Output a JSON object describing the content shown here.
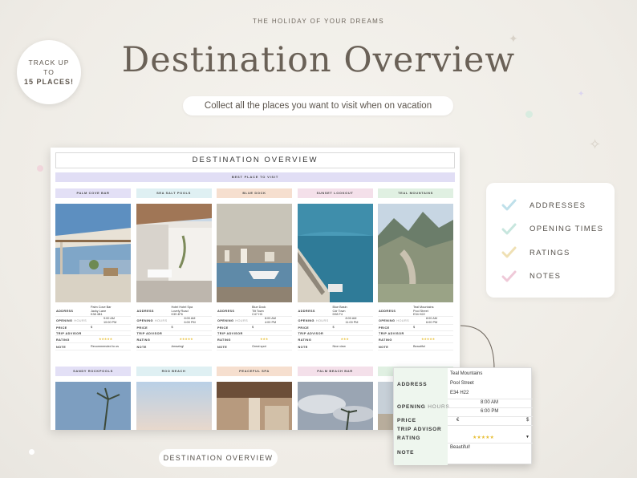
{
  "header": {
    "tagline": "THE HOLIDAY OF YOUR DREAMS",
    "title": "Destination Overview",
    "subtitle": "Collect all the places you want to visit when on vacation"
  },
  "badge": {
    "line1": "TRACK UP",
    "line2": "TO",
    "line3": "15 PLACES!"
  },
  "sheet": {
    "title": "DESTINATION OVERVIEW",
    "best_label": "BEST PLACE TO VISIT",
    "places": [
      {
        "name": "PALM COVE BAR",
        "head_color": "#e3e0f6",
        "address": [
          "Palm Cove Bar",
          "Jacky Lane",
          "K38 4B1"
        ],
        "open": "9:00 AM",
        "close": "10:00 PM",
        "price": "$",
        "rating": "★★★★★",
        "note": "Recommended to us"
      },
      {
        "name": "SEA SALT POOLS",
        "head_color": "#dff0f3",
        "address": [
          "Hotel Hotel Spa",
          "Lovely Road",
          "K39 4F6"
        ],
        "open": "8:00 AM",
        "close": "6:00 PM",
        "price": "$",
        "rating": "★★★★★",
        "note": "Amazing!"
      },
      {
        "name": "BLUE DOCK",
        "head_color": "#f6dfcf",
        "address": [
          "Blue Dock",
          "Tilt Town",
          "C47 H3"
        ],
        "open": "8:00 AM",
        "close": "4:00 PM",
        "price": "$",
        "rating": "★★★",
        "note": "Great spot"
      },
      {
        "name": "SUNSET LOOKOUT",
        "head_color": "#f4e0ea",
        "address": [
          "Blue Basin",
          "Cdr Town",
          "D98 F4"
        ],
        "open": "8:00 AM",
        "close": "11:00 PM",
        "price": "$",
        "rating": "★★★",
        "note": "Nice view"
      },
      {
        "name": "TEAL MOUNTAINS",
        "head_color": "#e0f0e2",
        "address": [
          "Teal Mountains",
          "Pool Street",
          "E34 H22"
        ],
        "open": "8:00 AM",
        "close": "6:00 PM",
        "price": "$",
        "rating": "★★★★★",
        "note": "Beautiful"
      }
    ],
    "labels": {
      "address": "ADDRESS",
      "opening": "OPENING",
      "hours": "HOURS",
      "price": "PRICE",
      "trip": "TRIP ADVISOR",
      "rating": "RATING",
      "note": "NOTE"
    },
    "places_row2": [
      {
        "name": "SANDY ROCKPOOLS",
        "head_color": "#e3e0f6"
      },
      {
        "name": "ROO BEACH",
        "head_color": "#dff0f3"
      },
      {
        "name": "PEACEFUL SPA",
        "head_color": "#f6dfcf"
      },
      {
        "name": "PALM BEACH BAR",
        "head_color": "#f4e0ea"
      },
      {
        "name": "",
        "head_color": "#e0f0e2"
      }
    ]
  },
  "checklist": [
    {
      "label": "ADDRESSES",
      "color": "#bfe0ea"
    },
    {
      "label": "OPENING TIMES",
      "color": "#c7e6de"
    },
    {
      "label": "RATINGS",
      "color": "#efe0b4"
    },
    {
      "label": "NOTES",
      "color": "#efc9d8"
    }
  ],
  "zoom": {
    "address_label": "ADDRESS",
    "address": [
      "Teal Mountains",
      "Pool Street",
      "E34 H22"
    ],
    "opening_label": "OPENING",
    "hours_label": "HOURS",
    "open": "8:00 AM",
    "close": "6:00 PM",
    "price_label": "PRICE",
    "currency": "€",
    "price_value": "$",
    "trip_label": "TRIP ADVISOR",
    "rating_label": "RATING",
    "rating": "★★★★★",
    "note_label": "NOTE",
    "note": "Beautiful!"
  },
  "footer": {
    "label": "DESTINATION OVERVIEW"
  }
}
